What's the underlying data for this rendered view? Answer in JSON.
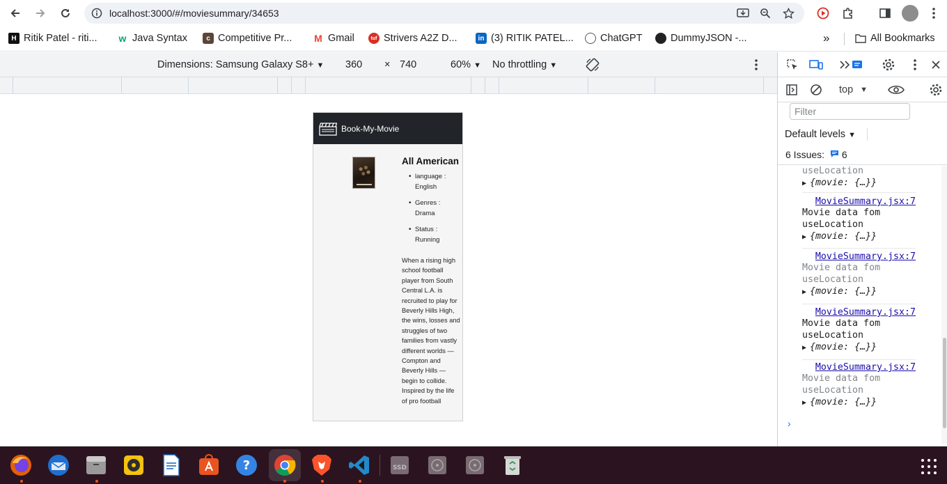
{
  "browser": {
    "url": "localhost:3000/#/moviesummary/34653",
    "bookmarks": [
      {
        "label": "Ritik Patel - riti...",
        "icon": "hashnode-icon"
      },
      {
        "label": "Java Syntax",
        "icon": "w3-icon"
      },
      {
        "label": "Competitive Pr...",
        "icon": "codechef-icon"
      },
      {
        "label": "Gmail",
        "icon": "gmail-icon"
      },
      {
        "label": "Strivers A2Z D...",
        "icon": "tuf-icon"
      },
      {
        "label": "(3) RITIK PATEL...",
        "icon": "linkedin-icon"
      },
      {
        "label": "ChatGPT",
        "icon": "openai-icon"
      },
      {
        "label": "DummyJSON -...",
        "icon": "dummyjson-icon"
      }
    ],
    "more_bookmarks": "»",
    "all_bookmarks": "All Bookmarks"
  },
  "device_toolbar": {
    "dimensions_label": "Dimensions: Samsung Galaxy S8+",
    "width": "360",
    "times": "×",
    "height": "740",
    "zoom": "60%",
    "throttling": "No throttling"
  },
  "app": {
    "brand": "Book-My-Movie",
    "movie": {
      "title": "All American",
      "details": [
        "language : English",
        "Genres : Drama",
        "Status : Running"
      ],
      "summary": "When a rising high school football player from South Central L.A. is recruited to play for Beverly Hills High, the wins, losses and struggles of two families from vastly different worlds — Compton and Beverly Hills — begin to collide. Inspired by the life of pro football"
    }
  },
  "devtools": {
    "context": "top",
    "filter_placeholder": "Filter",
    "levels": "Default levels",
    "issues_label": "6 Issues:",
    "issues_count": "6",
    "logs": [
      {
        "source": "",
        "message": "useLocation",
        "object": "{movie: {…}}",
        "dim": true
      },
      {
        "source": "MovieSummary.jsx:7",
        "message": "Movie data fom useLocation",
        "object": "{movie: {…}}",
        "dim": false
      },
      {
        "source": "MovieSummary.jsx:7",
        "message": "Movie data fom useLocation",
        "object": "{movie: {…}}",
        "dim": true
      },
      {
        "source": "MovieSummary.jsx:7",
        "message": "Movie data fom useLocation",
        "object": "{movie: {…}}",
        "dim": false
      },
      {
        "source": "MovieSummary.jsx:7",
        "message": "Movie data fom useLocation",
        "object": "{movie: {…}}",
        "dim": true
      }
    ],
    "prompt": "›"
  },
  "taskbar": {
    "apps": [
      "firefox-icon",
      "thunderbird-icon",
      "files-icon",
      "rhythmbox-icon",
      "writer-icon",
      "app-center-icon",
      "help-icon",
      "chrome-icon",
      "brave-icon",
      "vscode-icon",
      "ssd-icon",
      "disk-icon",
      "disk-icon",
      "trash-icon"
    ],
    "ssd_label": "SSD"
  },
  "colors": {
    "navbar": "#212529",
    "link": "#1a0dab",
    "accent": "#1a73e8",
    "taskbar": "#2b1420"
  }
}
